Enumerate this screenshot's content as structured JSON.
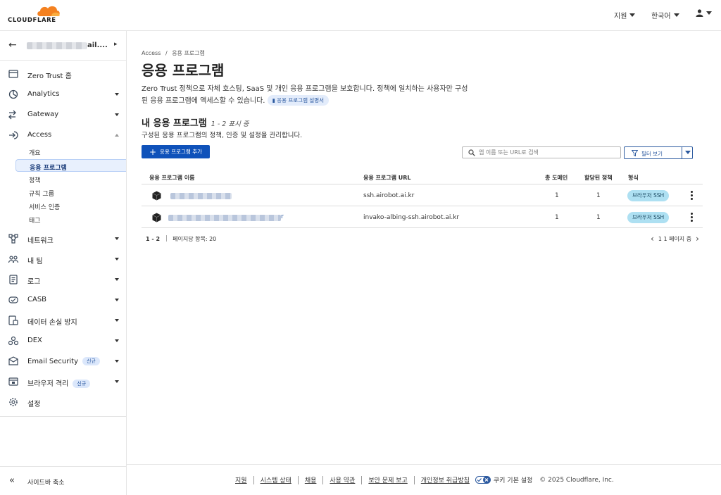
{
  "header": {
    "logo_text": "CLOUDFLARE",
    "menu_support": "지원",
    "menu_language": "한국어"
  },
  "sidebar": {
    "account_name": "ail....",
    "items": [
      {
        "label": "Zero Trust 홈",
        "icon": "home-icon"
      },
      {
        "label": "Analytics",
        "icon": "analytics-icon"
      },
      {
        "label": "Gateway",
        "icon": "gateway-icon"
      },
      {
        "label": "Access",
        "icon": "access-icon"
      },
      {
        "label": "네트워크",
        "icon": "network-icon"
      },
      {
        "label": "내 팀",
        "icon": "team-icon"
      },
      {
        "label": "로그",
        "icon": "logs-icon"
      },
      {
        "label": "CASB",
        "icon": "casb-icon"
      },
      {
        "label": "데이터 손실 방지",
        "icon": "dlp-icon"
      },
      {
        "label": "DEX",
        "icon": "dex-icon"
      },
      {
        "label": "Email Security",
        "icon": "email-icon",
        "badge": "신규"
      },
      {
        "label": "브라우저 격리",
        "icon": "browser-icon",
        "badge": "신규"
      },
      {
        "label": "설정",
        "icon": "gear-icon"
      }
    ],
    "access_sub": [
      "개요",
      "응용 프로그램",
      "정책",
      "규칙 그룹",
      "서비스 인증",
      "태그"
    ],
    "collapse_label": "사이드바 축소"
  },
  "main": {
    "breadcrumb_root": "Access",
    "breadcrumb_sep": "/",
    "breadcrumb_current": "응용 프로그램",
    "title": "응용 프로그램",
    "description_line1": "Zero Trust 정책으로 자체 호스팅, SaaS 및 개인 응용 프로그램을 보호합니다. 정책에 일치하는 사용자만 구성",
    "description_line2": "된 응용 프로그램에 액세스할 수 있습니다.",
    "doc_link": "응용 프로그램 설명서",
    "section_title": "내 응용 프로그램",
    "section_count": "1 - 2 표시 중",
    "section_desc": "구성된 응용 프로그램의 정책, 인증 및 설정을 관리합니다.",
    "add_button": "응용 프로그램 추가",
    "search_placeholder": "앱 이름 또는 URL로 검색",
    "filter_label": "필터 보기"
  },
  "table": {
    "headers": {
      "name": "응용 프로그램 이름",
      "url": "응용 프로그램 URL",
      "domains": "총 도메인",
      "policies": "할당된 정책",
      "type": "형식"
    },
    "rows": [
      {
        "name_tail": "",
        "url": "ssh.airobot.ai.kr",
        "domains": "1",
        "policies": "1",
        "type": "브라우저 SSH"
      },
      {
        "name_tail": "r",
        "url": "invako-albing-ssh.airobot.ai.kr",
        "domains": "1",
        "policies": "1",
        "type": "브라우저 SSH"
      }
    ]
  },
  "pagination": {
    "range": "1 - 2",
    "per_page": "페이지당 항목: 20",
    "page_info": "1 1 페이지 중"
  },
  "footer": {
    "links": [
      "지원",
      "시스템 상태",
      "채용",
      "사용 약관",
      "보안 문제 보고",
      "개인정보 취급방침"
    ],
    "cookie": "쿠키 기본 설정",
    "copyright": "© 2025 Cloudflare, Inc."
  },
  "colors": {
    "primary": "#0f52ba",
    "logo_orange": "#f48120",
    "type_badge": "#aee0f2",
    "active_nav": "#e8f0fd"
  }
}
